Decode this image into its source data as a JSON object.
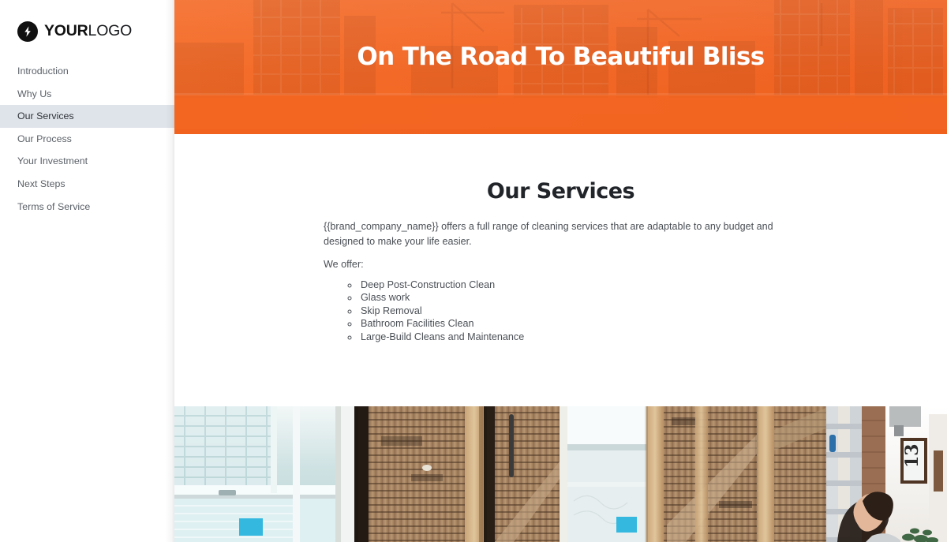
{
  "brand": {
    "logo_bold": "YOUR",
    "logo_light": "LOGO",
    "logo_icon": "lightning-bolt-icon",
    "accent_color": "#f26522",
    "active_nav_bg": "#dfe3ea",
    "text_color": "#4a4f55"
  },
  "sidebar": {
    "items": [
      {
        "label": "Introduction",
        "active": false
      },
      {
        "label": "Why Us",
        "active": false
      },
      {
        "label": "Our Services",
        "active": true
      },
      {
        "label": "Our Process",
        "active": false
      },
      {
        "label": "Your Investment",
        "active": false
      },
      {
        "label": "Next Steps",
        "active": false
      },
      {
        "label": "Terms of Service",
        "active": false
      }
    ]
  },
  "hero": {
    "title": "On The Road To Beautiful Bliss",
    "background": "construction-site-photo-orange-overlay"
  },
  "main": {
    "section_title": "Our Services",
    "paragraph": "{{brand_company_name}} offers a full range of cleaning services that are adaptable to any budget and designed to make your life easier.",
    "offer_label": "We offer:",
    "services": [
      "Deep Post-Construction Clean",
      "Glass work",
      "Skip Removal",
      "Bathroom Facilities Clean",
      "Large-Build Cleans and Maintenance"
    ]
  },
  "photo": {
    "caption": "interior-renovation-photo-woman-with-ladder"
  }
}
